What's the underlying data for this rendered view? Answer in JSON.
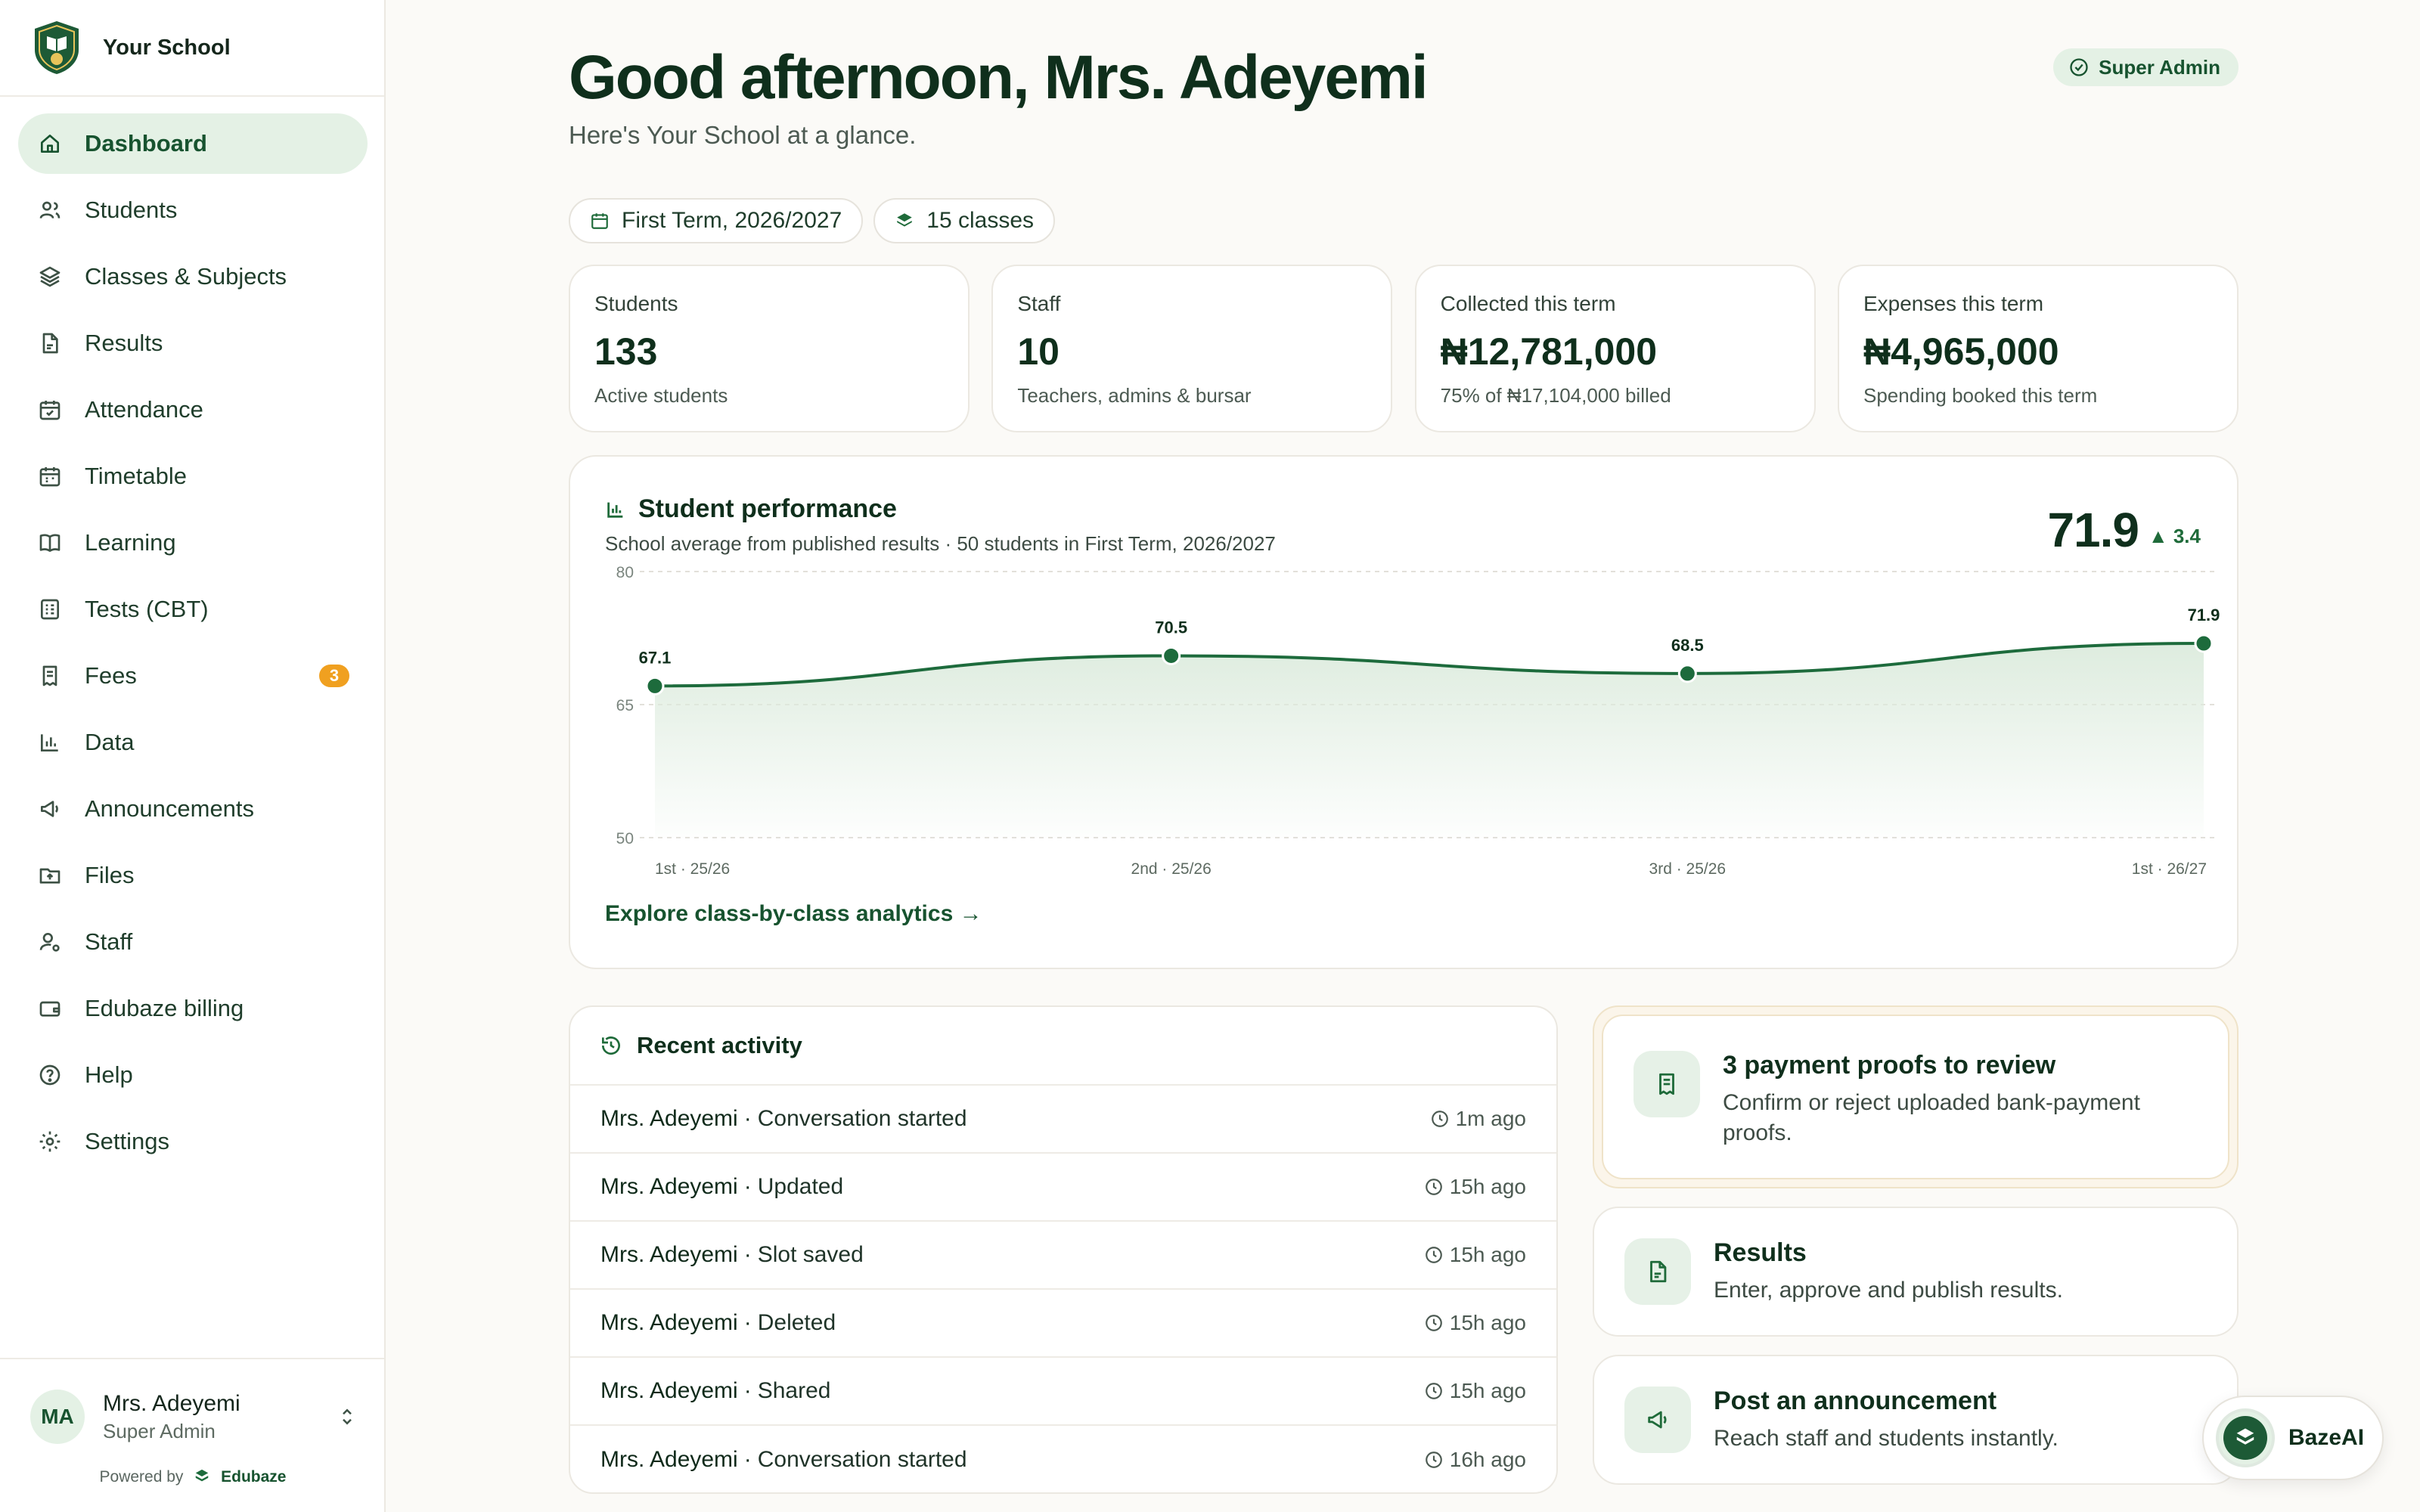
{
  "brand": {
    "name": "Your School",
    "logo_icon": "school-crest-icon"
  },
  "sidebar": {
    "items": [
      {
        "label": "Dashboard",
        "icon": "home-icon",
        "active": true
      },
      {
        "label": "Students",
        "icon": "users-icon"
      },
      {
        "label": "Classes & Subjects",
        "icon": "layers-icon"
      },
      {
        "label": "Results",
        "icon": "document-icon"
      },
      {
        "label": "Attendance",
        "icon": "calendar-check-icon"
      },
      {
        "label": "Timetable",
        "icon": "calendar-icon"
      },
      {
        "label": "Learning",
        "icon": "book-icon"
      },
      {
        "label": "Tests (CBT)",
        "icon": "test-icon"
      },
      {
        "label": "Fees",
        "icon": "receipt-icon",
        "badge": "3"
      },
      {
        "label": "Data",
        "icon": "bar-chart-icon"
      },
      {
        "label": "Announcements",
        "icon": "megaphone-icon"
      },
      {
        "label": "Files",
        "icon": "folder-icon"
      },
      {
        "label": "Staff",
        "icon": "user-cog-icon"
      },
      {
        "label": "Edubaze billing",
        "icon": "wallet-icon"
      },
      {
        "label": "Help",
        "icon": "help-icon"
      },
      {
        "label": "Settings",
        "icon": "settings-icon"
      }
    ],
    "user": {
      "initials": "MA",
      "name": "Mrs. Adeyemi",
      "role": "Super Admin"
    },
    "powered_by": {
      "prefix": "Powered by",
      "brand": "Edubaze"
    }
  },
  "header": {
    "greeting": "Good afternoon, Mrs. Adeyemi",
    "subtitle": "Here's Your School at a glance.",
    "role_badge": "Super Admin",
    "chips": {
      "term": "First Term, 2026/2027",
      "classes": "15 classes"
    }
  },
  "stats": [
    {
      "label": "Students",
      "value": "133",
      "note": "Active students"
    },
    {
      "label": "Staff",
      "value": "10",
      "note": "Teachers, admins & bursar"
    },
    {
      "label": "Collected this term",
      "value": "₦12,781,000",
      "note": "75% of ₦17,104,000 billed"
    },
    {
      "label": "Expenses this term",
      "value": "₦4,965,000",
      "note": "Spending booked this term"
    }
  ],
  "performance": {
    "title": "Student performance",
    "subtitle": "School average from published results · 50 students in First Term, 2026/2027",
    "current": "71.9",
    "delta": "▲ 3.4",
    "link": "Explore class-by-class analytics →"
  },
  "chart_data": {
    "type": "area",
    "categories": [
      "1st · 25/26",
      "2nd · 25/26",
      "3rd · 25/26",
      "1st · 26/27"
    ],
    "values": [
      67.1,
      70.5,
      68.5,
      71.9
    ],
    "data_labels": [
      "67.1",
      "70.5",
      "68.5",
      "71.9"
    ],
    "y_ticks": [
      "80",
      "65",
      "50"
    ],
    "ylim": [
      50,
      80
    ],
    "grid": true,
    "colors": {
      "line": "#1d6b3c",
      "fill": "#dcebdd"
    }
  },
  "activity": {
    "title": "Recent activity",
    "rows": [
      {
        "who": "Mrs. Adeyemi",
        "what": "Conversation started",
        "time": "1m ago"
      },
      {
        "who": "Mrs. Adeyemi",
        "what": "Updated",
        "time": "15h ago"
      },
      {
        "who": "Mrs. Adeyemi",
        "what": "Slot saved",
        "time": "15h ago"
      },
      {
        "who": "Mrs. Adeyemi",
        "what": "Deleted",
        "time": "15h ago"
      },
      {
        "who": "Mrs. Adeyemi",
        "what": "Shared",
        "time": "15h ago"
      },
      {
        "who": "Mrs. Adeyemi",
        "what": "Conversation started",
        "time": "16h ago"
      }
    ]
  },
  "actions": [
    {
      "title": "3 payment proofs to review",
      "desc": "Confirm or reject uploaded bank-payment proofs.",
      "icon": "receipt-icon"
    },
    {
      "title": "Results",
      "desc": "Enter, approve and publish results.",
      "icon": "document-icon"
    },
    {
      "title": "Post an announcement",
      "desc": "Reach staff and students instantly.",
      "icon": "megaphone-icon"
    }
  ],
  "assistant": {
    "label": "BazeAI"
  }
}
